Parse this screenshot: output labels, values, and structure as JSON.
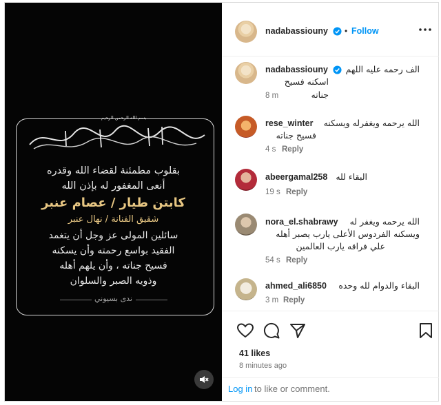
{
  "post": {
    "image": {
      "basmala": "بسم الله الرحمن الرحيم",
      "calligraphy": "وَبَشِّرِ الصَّابِرِينَ الَّذِينَ إِذَا أَصَابَتْهُم مُّصِيبَةٌ قَالُوا إِنَّا لِلَّهِ وَإِنَّا إِلَيْهِ رَاجِعُونَ",
      "lines": [
        "بقلوب مطمئنة لقضاء الله وقدره",
        "أنعى المغفور له بإذن الله",
        "كابتن طيار / عصام عنبر",
        "شقيق الفنانة / نهال عنبر",
        "سائلين المولى عز وجل أن يتغمد",
        "الفقيد بواسع رحمته وأن يسكنه",
        "فسيح جناته ، وأن يلهم أهله",
        "وذويه الصبر والسلوان"
      ],
      "signature": "ندى بسيوني",
      "mute_icon": "speaker-muted-icon"
    },
    "header": {
      "username": "nadabassiouny",
      "separator": "•",
      "follow_label": "Follow",
      "more_icon": "more-horizontal-icon"
    },
    "caption": {
      "username": "nadabassiouny",
      "text_line1": "الف رحمه عليه اللهم",
      "text_line2": "اسكنه فسيح جناته",
      "time": "8 m"
    },
    "comments": [
      {
        "username": "rese_winter",
        "line1": "الله يرحمه ويغفرله ويسكنه",
        "line2": "فسيح جناته",
        "time": "4 s",
        "reply": "Reply"
      },
      {
        "username": "abeergamal258",
        "line1": "البقاء لله",
        "time": "19 s",
        "reply": "Reply"
      },
      {
        "username": "nora_el.shabrawy",
        "line1": "الله يرحمه ويغفر له",
        "line2": "ويسكنه الفردوس الأعلى يارب يصبر أهله",
        "line3": "علي فراقه يارب العالمين",
        "time": "54 s",
        "reply": "Reply"
      },
      {
        "username": "ahmed_ali6850",
        "line1": "البقاء والدوام لله وحده",
        "time": "3 m",
        "reply": "Reply"
      }
    ],
    "actions": {
      "like_icon": "heart-icon",
      "comment_icon": "comment-icon",
      "share_icon": "share-icon",
      "save_icon": "bookmark-icon"
    },
    "likes": "41 likes",
    "posted_ago": "8 minutes ago",
    "footer": {
      "login_link": "Log in",
      "login_rest": "to like or comment."
    },
    "colors": {
      "accent": "#0095f6",
      "gold_text": "#e8c783",
      "verified_badge": "#0095f6"
    }
  }
}
